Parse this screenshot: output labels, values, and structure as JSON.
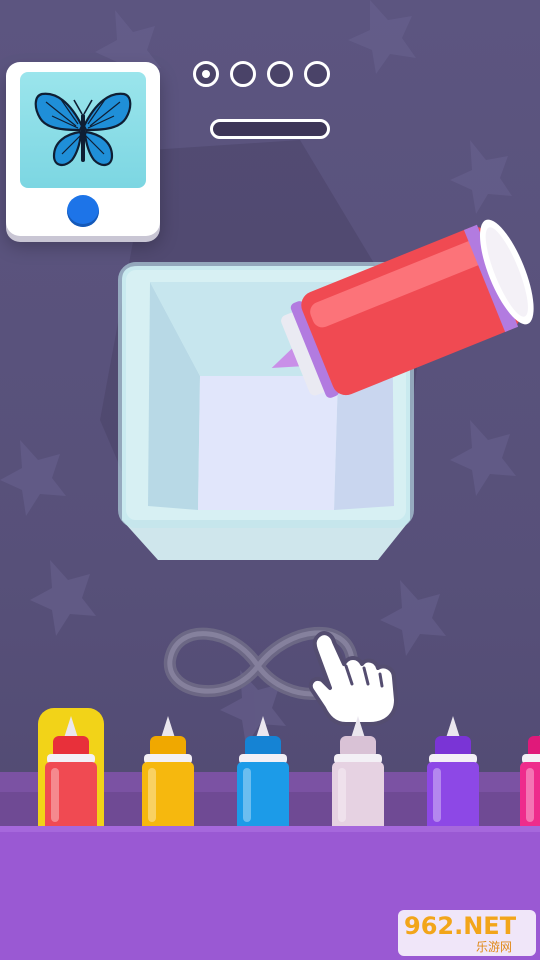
{
  "level_indicator": {
    "dots": [
      {
        "state": "current"
      },
      {
        "state": "empty"
      },
      {
        "state": "empty"
      },
      {
        "state": "empty"
      }
    ]
  },
  "progress": {
    "fraction": 0.0
  },
  "target_card": {
    "picture": "butterfly-icon",
    "button_color": "#1d74e8"
  },
  "gesture_hint": {
    "shape": "infinity-loop",
    "icon": "pointing-hand-icon"
  },
  "active_bottle": {
    "color": "#f04a52"
  },
  "bottles": [
    {
      "name": "red",
      "color": "#f04a52",
      "cap": "#e8303a",
      "selected": true
    },
    {
      "name": "yellow",
      "color": "#f6b80e",
      "cap": "#f0a800",
      "selected": false
    },
    {
      "name": "blue",
      "color": "#1c9be8",
      "cap": "#1583d4",
      "selected": false
    },
    {
      "name": "pink-white",
      "color": "#e6d2e2",
      "cap": "#d9c2d6",
      "selected": false
    },
    {
      "name": "purple",
      "color": "#8d48e6",
      "cap": "#7a34d6",
      "selected": false
    },
    {
      "name": "magenta",
      "color": "#ee2c8c",
      "cap": "#e0197a",
      "selected": false
    }
  ],
  "watermark": {
    "main": "962.NET",
    "sub": "乐游网"
  }
}
